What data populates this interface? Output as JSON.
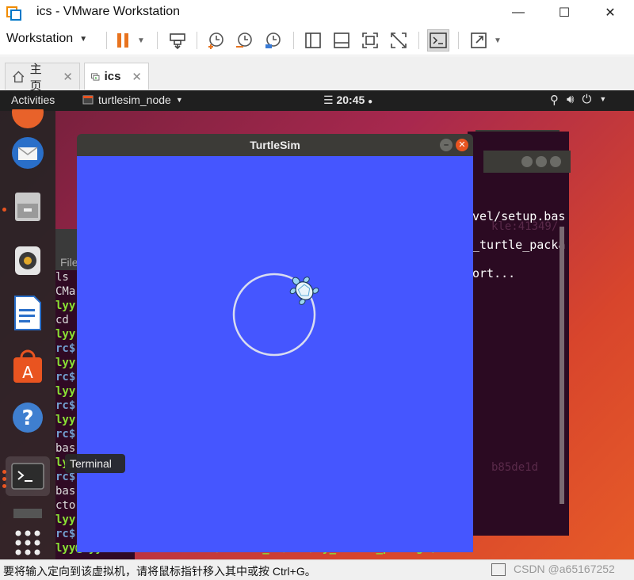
{
  "window": {
    "title": "ics - VMware Workstation",
    "minimize": "—",
    "maximize": "☐",
    "close": "✕"
  },
  "toolbar": {
    "workstation_label": "Workstation",
    "icons": [
      "pause-icon",
      "send-keys-icon",
      "snapshot-icon",
      "revert-snapshot-icon",
      "manage-snapshots-icon",
      "library-icon",
      "thumbnail-icon",
      "fullscreen-icon",
      "unity-icon",
      "console-icon",
      "stretch-icon"
    ]
  },
  "tabs": [
    {
      "label": "主页",
      "close": "✕"
    },
    {
      "label": "ics",
      "close": "✕"
    }
  ],
  "gnome": {
    "activities": "Activities",
    "app_menu": "turtlesim_node",
    "clock": "20:45",
    "accent": "#e95420"
  },
  "turtlesim": {
    "title": "TurtleSim",
    "background": "#4556ff"
  },
  "background_terminal": {
    "header": "File",
    "lines": [
      "ls",
      "CMa",
      "lyy",
      "cd",
      "lyy",
      "rc$",
      "lyy",
      "rc$",
      "lyy",
      "rc$",
      "lyy",
      "rc$",
      "bas",
      "lyy",
      "rc$",
      "bas",
      "cto",
      "lyy",
      "rc$",
      "lyy@lyy-VirtualMachine:~/catkin_ws/src/my_turtle_package$"
    ]
  },
  "right_terminal": {
    "lines": [
      "vel/setup.bas",
      "kle:41349/",
      "_turtle_packa",
      "ort..."
    ],
    "faint": "b85de1d"
  },
  "dock_tooltip": "Terminal",
  "statusbar": {
    "message": "要将输入定向到该虚拟机，请将鼠标指针移入其中或按 Ctrl+G。",
    "watermark": "CSDN @a65167252"
  }
}
